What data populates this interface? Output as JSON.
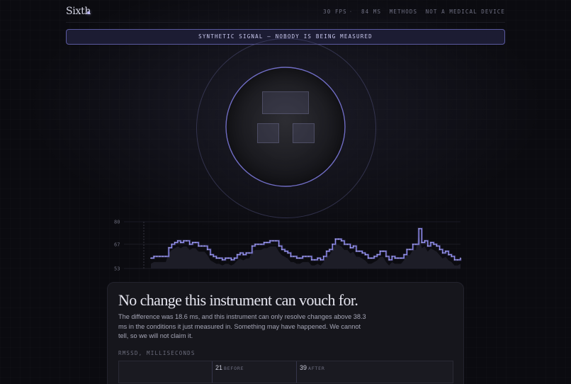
{
  "header": {
    "brand": "Sixth",
    "fps": "30 FPS",
    "latency": "84 MS",
    "methods_link": "METHODS",
    "disclaimer": "NOT A MEDICAL DEVICE"
  },
  "banner": {
    "text": "SYNTHETIC SIGNAL — NOBODY IS BEING MEASURED"
  },
  "colors": {
    "accent": "#8f8cf0",
    "background": "#0b0b10",
    "card": "#16161c"
  },
  "chart_data": {
    "type": "line",
    "title": "",
    "xlabel": "",
    "ylabel": "",
    "ylim": [
      53,
      80
    ],
    "yticks": [
      "80",
      "67",
      "53"
    ],
    "grid": true,
    "series": [
      {
        "values": [
          59,
          60,
          60,
          60,
          60,
          60,
          65,
          67,
          68,
          69,
          68,
          69,
          69,
          67,
          68,
          68,
          66,
          66,
          66,
          64,
          61,
          60,
          59,
          59,
          58,
          59,
          59,
          58,
          59,
          61,
          62,
          61,
          62,
          62,
          66,
          67,
          67,
          67,
          68,
          68,
          69,
          69,
          69,
          66,
          64,
          63,
          62,
          60,
          60,
          59,
          59,
          60,
          60,
          60,
          58,
          58,
          59,
          58,
          60,
          63,
          64,
          67,
          70,
          70,
          69,
          67,
          67,
          65,
          66,
          63,
          63,
          62,
          61,
          59,
          59,
          60,
          61,
          63,
          63,
          60,
          58,
          60,
          59,
          59,
          59,
          61,
          64,
          64,
          67,
          67,
          76,
          68,
          69,
          66,
          68,
          67,
          66,
          64,
          62,
          63,
          61,
          60,
          58,
          58,
          59
        ]
      }
    ]
  },
  "result": {
    "title": "No change this instrument can vouch for.",
    "body": "The difference was 18.6 ms, and this instrument can only resolve changes above 38.3 ms in the conditions it just measured in. Something may have happened. We cannot tell, so we will not claim it.",
    "metric_label": "RMSSD, MILLISECONDS",
    "before_value": "21",
    "before_label": "BEFORE",
    "after_value": "39",
    "after_label": "AFTER"
  }
}
